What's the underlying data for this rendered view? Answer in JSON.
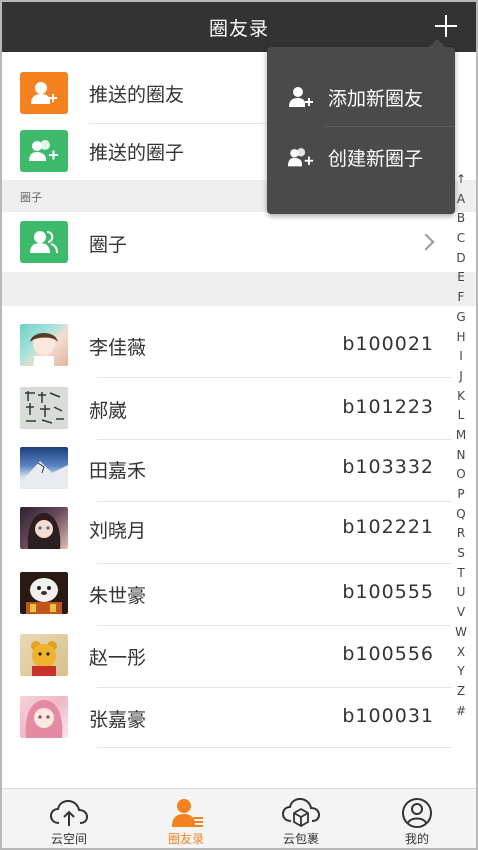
{
  "header": {
    "title": "圈友录"
  },
  "menu": {
    "items": [
      {
        "label": "添加新圈友",
        "icon": "add-user-icon"
      },
      {
        "label": "创建新圈子",
        "icon": "add-group-icon"
      }
    ]
  },
  "top_items": [
    {
      "label": "推送的圈友",
      "icon": "add-user-icon",
      "color": "#f5821f"
    },
    {
      "label": "推送的圈子",
      "icon": "add-group-icon",
      "color": "#3dba6b"
    }
  ],
  "circles_section": {
    "label": "圈子",
    "item_label": "圈子",
    "item_icon": "group-icon",
    "color": "#3dba6b"
  },
  "contacts": [
    {
      "name": "李佳薇",
      "id": "b100021"
    },
    {
      "name": "郝崴",
      "id": "b101223"
    },
    {
      "name": "田嘉禾",
      "id": "b103332"
    },
    {
      "name": "刘晓月",
      "id": "b102221"
    },
    {
      "name": "朱世豪",
      "id": "b100555"
    },
    {
      "name": "赵一彤",
      "id": "b100556"
    },
    {
      "name": "张嘉豪",
      "id": "b100031"
    }
  ],
  "alphabet": [
    "↑",
    "A",
    "B",
    "C",
    "D",
    "E",
    "F",
    "G",
    "H",
    "I",
    "J",
    "K",
    "L",
    "M",
    "N",
    "O",
    "P",
    "Q",
    "R",
    "S",
    "T",
    "U",
    "V",
    "W",
    "X",
    "Y",
    "Z",
    "#"
  ],
  "tabbar": {
    "tabs": [
      {
        "label": "云空间",
        "icon": "cloud-upload-icon"
      },
      {
        "label": "圈友录",
        "icon": "contacts-icon",
        "active": true
      },
      {
        "label": "云包裹",
        "icon": "cloud-package-icon"
      },
      {
        "label": "我的",
        "icon": "profile-icon"
      }
    ]
  },
  "colors": {
    "accent": "#f5821f",
    "green": "#3dba6b",
    "header": "#333333",
    "menu": "#4a4a4a"
  }
}
